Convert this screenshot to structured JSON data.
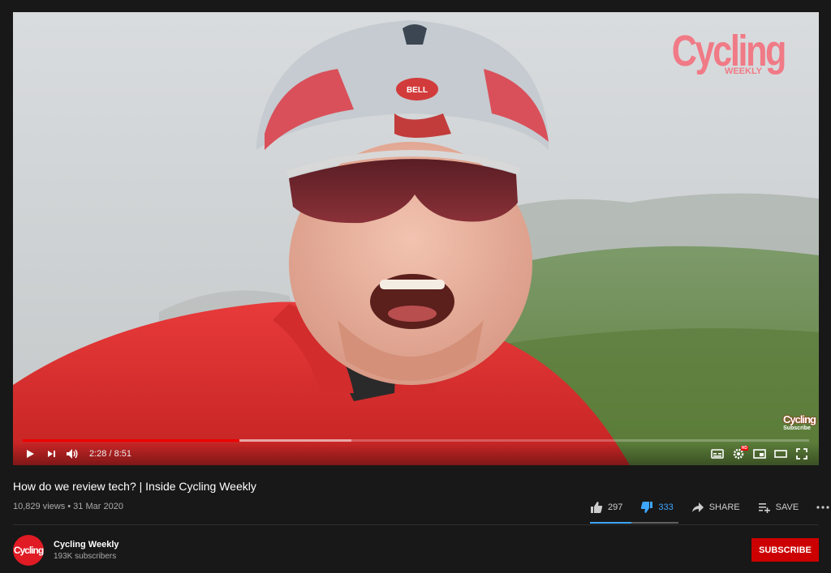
{
  "video": {
    "brand_logo_main": "Cycling",
    "brand_logo_sub": "WEEKLY",
    "corner_logo_main": "Cycling",
    "corner_logo_sub": "Subscribe",
    "played_fraction": 0.276,
    "buffered_fraction": 0.418
  },
  "controls": {
    "time": "2:28 / 8:51",
    "icons": [
      "play-icon",
      "next-icon",
      "volume-icon",
      "subtitles-icon",
      "settings-icon",
      "miniplayer-icon",
      "theater-icon",
      "fullscreen-icon"
    ],
    "settings_badge": "HD"
  },
  "info": {
    "title": "How do we review tech? | Inside Cycling Weekly",
    "meta": "10,829 views • 31 Mar 2020",
    "likes": "297",
    "dislikes": "333",
    "share_label": "SHARE",
    "save_label": "SAVE",
    "like_ratio": 0.47,
    "accent": "#3ea6ff"
  },
  "channel": {
    "avatar_text": "Cycling",
    "name": "Cycling Weekly",
    "subscribers": "193K subscribers",
    "subscribe_label": "SUBSCRIBE",
    "subscribe_color": "#cc0000"
  }
}
